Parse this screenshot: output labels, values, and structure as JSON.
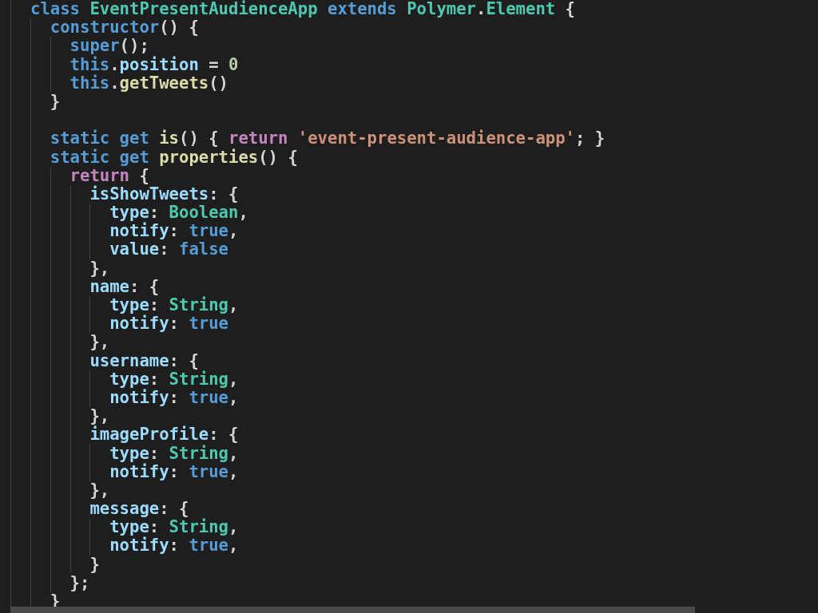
{
  "editor": {
    "lines": [
      {
        "tokens": [
          {
            "kind": "keyword",
            "text": "class"
          },
          {
            "kind": "type",
            "text": " EventPresentAudienceApp"
          },
          {
            "kind": "keyword",
            "text": " extends"
          },
          {
            "kind": "type",
            "text": " Polymer"
          },
          {
            "kind": "plain",
            "text": "."
          },
          {
            "kind": "type",
            "text": "Element"
          },
          {
            "kind": "plain",
            "text": " {"
          }
        ],
        "children": [
          {
            "tokens": [
              {
                "kind": "keyword",
                "text": "constructor"
              },
              {
                "kind": "plain",
                "text": "() {"
              }
            ],
            "children": [
              {
                "tokens": [
                  {
                    "kind": "keyword",
                    "text": "super"
                  },
                  {
                    "kind": "plain",
                    "text": "();"
                  }
                ]
              },
              {
                "tokens": [
                  {
                    "kind": "keyword",
                    "text": "this"
                  },
                  {
                    "kind": "plain",
                    "text": "."
                  },
                  {
                    "kind": "property",
                    "text": "position"
                  },
                  {
                    "kind": "plain",
                    "text": " ="
                  },
                  {
                    "kind": "number",
                    "text": " 0"
                  }
                ]
              },
              {
                "tokens": [
                  {
                    "kind": "keyword",
                    "text": "this"
                  },
                  {
                    "kind": "plain",
                    "text": "."
                  },
                  {
                    "kind": "function",
                    "text": "getTweets"
                  },
                  {
                    "kind": "plain",
                    "text": "()"
                  }
                ]
              }
            ]
          },
          {
            "tokens": [
              {
                "kind": "plain",
                "text": "}"
              }
            ]
          },
          {
            "blank_before": true,
            "tokens": [
              {
                "kind": "keyword",
                "text": "static"
              },
              {
                "kind": "keyword",
                "text": " get"
              },
              {
                "kind": "function",
                "text": " is"
              },
              {
                "kind": "plain",
                "text": "() {"
              },
              {
                "kind": "control",
                "text": " return"
              },
              {
                "kind": "string",
                "text": " 'event-present-audience-app'"
              },
              {
                "kind": "plain",
                "text": "; }"
              }
            ]
          },
          {
            "tokens": [
              {
                "kind": "keyword",
                "text": "static"
              },
              {
                "kind": "keyword",
                "text": " get"
              },
              {
                "kind": "function",
                "text": " properties"
              },
              {
                "kind": "plain",
                "text": "() {"
              }
            ],
            "children": [
              {
                "tokens": [
                  {
                    "kind": "control",
                    "text": "return"
                  },
                  {
                    "kind": "plain",
                    "text": " {"
                  }
                ],
                "children": [
                  {
                    "tokens": [
                      {
                        "kind": "property",
                        "text": "isShowTweets"
                      },
                      {
                        "kind": "plain",
                        "text": ": {"
                      }
                    ],
                    "children": [
                      {
                        "tokens": [
                          {
                            "kind": "property",
                            "text": "type"
                          },
                          {
                            "kind": "plain",
                            "text": ":"
                          },
                          {
                            "kind": "type",
                            "text": " Boolean"
                          },
                          {
                            "kind": "plain",
                            "text": ","
                          }
                        ]
                      },
                      {
                        "tokens": [
                          {
                            "kind": "property",
                            "text": "notify"
                          },
                          {
                            "kind": "plain",
                            "text": ":"
                          },
                          {
                            "kind": "keyword",
                            "text": " true"
                          },
                          {
                            "kind": "plain",
                            "text": ","
                          }
                        ]
                      },
                      {
                        "tokens": [
                          {
                            "kind": "property",
                            "text": "value"
                          },
                          {
                            "kind": "plain",
                            "text": ":"
                          },
                          {
                            "kind": "keyword",
                            "text": " false"
                          }
                        ]
                      }
                    ]
                  },
                  {
                    "tokens": [
                      {
                        "kind": "plain",
                        "text": "},"
                      }
                    ]
                  },
                  {
                    "tokens": [
                      {
                        "kind": "property",
                        "text": "name"
                      },
                      {
                        "kind": "plain",
                        "text": ": {"
                      }
                    ],
                    "children": [
                      {
                        "tokens": [
                          {
                            "kind": "property",
                            "text": "type"
                          },
                          {
                            "kind": "plain",
                            "text": ":"
                          },
                          {
                            "kind": "type",
                            "text": " String"
                          },
                          {
                            "kind": "plain",
                            "text": ","
                          }
                        ]
                      },
                      {
                        "tokens": [
                          {
                            "kind": "property",
                            "text": "notify"
                          },
                          {
                            "kind": "plain",
                            "text": ":"
                          },
                          {
                            "kind": "keyword",
                            "text": " true"
                          }
                        ]
                      }
                    ]
                  },
                  {
                    "tokens": [
                      {
                        "kind": "plain",
                        "text": "},"
                      }
                    ]
                  },
                  {
                    "tokens": [
                      {
                        "kind": "property",
                        "text": "username"
                      },
                      {
                        "kind": "plain",
                        "text": ": {"
                      }
                    ],
                    "children": [
                      {
                        "tokens": [
                          {
                            "kind": "property",
                            "text": "type"
                          },
                          {
                            "kind": "plain",
                            "text": ":"
                          },
                          {
                            "kind": "type",
                            "text": " String"
                          },
                          {
                            "kind": "plain",
                            "text": ","
                          }
                        ]
                      },
                      {
                        "tokens": [
                          {
                            "kind": "property",
                            "text": "notify"
                          },
                          {
                            "kind": "plain",
                            "text": ":"
                          },
                          {
                            "kind": "keyword",
                            "text": " true"
                          },
                          {
                            "kind": "plain",
                            "text": ","
                          }
                        ]
                      }
                    ]
                  },
                  {
                    "tokens": [
                      {
                        "kind": "plain",
                        "text": "},"
                      }
                    ]
                  },
                  {
                    "tokens": [
                      {
                        "kind": "property",
                        "text": "imageProfile"
                      },
                      {
                        "kind": "plain",
                        "text": ": {"
                      }
                    ],
                    "children": [
                      {
                        "tokens": [
                          {
                            "kind": "property",
                            "text": "type"
                          },
                          {
                            "kind": "plain",
                            "text": ":"
                          },
                          {
                            "kind": "type",
                            "text": " String"
                          },
                          {
                            "kind": "plain",
                            "text": ","
                          }
                        ]
                      },
                      {
                        "tokens": [
                          {
                            "kind": "property",
                            "text": "notify"
                          },
                          {
                            "kind": "plain",
                            "text": ":"
                          },
                          {
                            "kind": "keyword",
                            "text": " true"
                          },
                          {
                            "kind": "plain",
                            "text": ","
                          }
                        ]
                      }
                    ]
                  },
                  {
                    "tokens": [
                      {
                        "kind": "plain",
                        "text": "},"
                      }
                    ]
                  },
                  {
                    "tokens": [
                      {
                        "kind": "property",
                        "text": "message"
                      },
                      {
                        "kind": "plain",
                        "text": ": {"
                      }
                    ],
                    "children": [
                      {
                        "tokens": [
                          {
                            "kind": "property",
                            "text": "type"
                          },
                          {
                            "kind": "plain",
                            "text": ":"
                          },
                          {
                            "kind": "type",
                            "text": " String"
                          },
                          {
                            "kind": "plain",
                            "text": ","
                          }
                        ]
                      },
                      {
                        "tokens": [
                          {
                            "kind": "property",
                            "text": "notify"
                          },
                          {
                            "kind": "plain",
                            "text": ":"
                          },
                          {
                            "kind": "keyword",
                            "text": " true"
                          },
                          {
                            "kind": "plain",
                            "text": ","
                          }
                        ]
                      }
                    ]
                  },
                  {
                    "tokens": [
                      {
                        "kind": "plain",
                        "text": "}"
                      }
                    ]
                  }
                ]
              },
              {
                "tokens": [
                  {
                    "kind": "plain",
                    "text": "};"
                  }
                ]
              }
            ]
          },
          {
            "tokens": [
              {
                "kind": "plain",
                "text": "}"
              }
            ]
          }
        ]
      }
    ]
  }
}
